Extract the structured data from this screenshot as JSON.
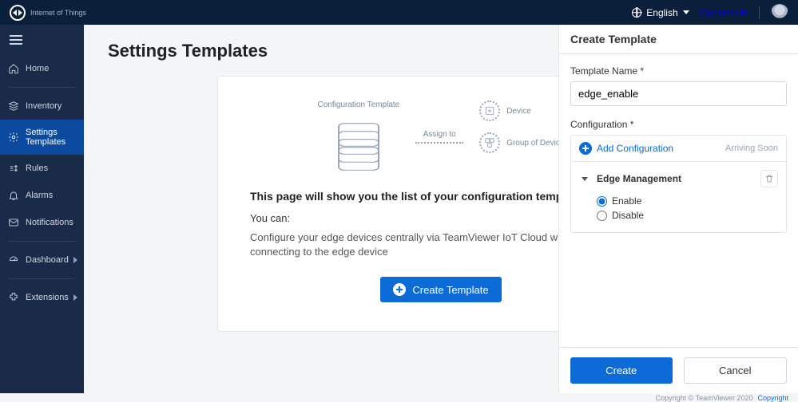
{
  "brand": {
    "name": "TeamViewer",
    "subtitle": "Internet of Things"
  },
  "topbar": {
    "language": "English",
    "contact_label": "Contact Us"
  },
  "sidebar": {
    "items": [
      {
        "id": "home",
        "label": "Home",
        "icon": "home-icon"
      },
      {
        "id": "inventory",
        "label": "Inventory",
        "icon": "inventory-icon"
      },
      {
        "id": "settings",
        "label": "Settings Templates",
        "icon": "settings-templates-icon",
        "active": true
      },
      {
        "id": "rules",
        "label": "Rules",
        "icon": "rules-icon"
      },
      {
        "id": "alarms",
        "label": "Alarms",
        "icon": "alarms-icon"
      },
      {
        "id": "notifications",
        "label": "Notifications",
        "icon": "notifications-icon"
      },
      {
        "id": "dashboard",
        "label": "Dashboard",
        "icon": "dashboard-icon",
        "caret": true
      },
      {
        "id": "extensions",
        "label": "Extensions",
        "icon": "extensions-icon",
        "caret": true
      }
    ]
  },
  "page": {
    "title": "Settings Templates",
    "diagram": {
      "left_label": "Configuration Template",
      "assign_label": "Assign to",
      "device_label": "Device",
      "group_label": "Group of Device"
    },
    "empty": {
      "headline": "This page will show you the list of your configuration templates",
      "you_can": "You can:",
      "desc": "Configure your edge devices centrally via TeamViewer IoT Cloud without directly connecting to the edge device",
      "button_label": "Create Template"
    }
  },
  "drawer": {
    "title": "Create Template",
    "name_label": "Template Name *",
    "name_value": "edge_enable",
    "config_label": "Configuration *",
    "add_config_label": "Add Configuration",
    "arriving_soon_label": "Arriving Soon",
    "section_title": "Edge Management",
    "radio_enable": "Enable",
    "radio_disable": "Disable",
    "radio_selected": "enable",
    "create_label": "Create",
    "cancel_label": "Cancel"
  },
  "footer": {
    "copyright": "Copyright © TeamViewer 2020",
    "link_label": "Copyright"
  }
}
